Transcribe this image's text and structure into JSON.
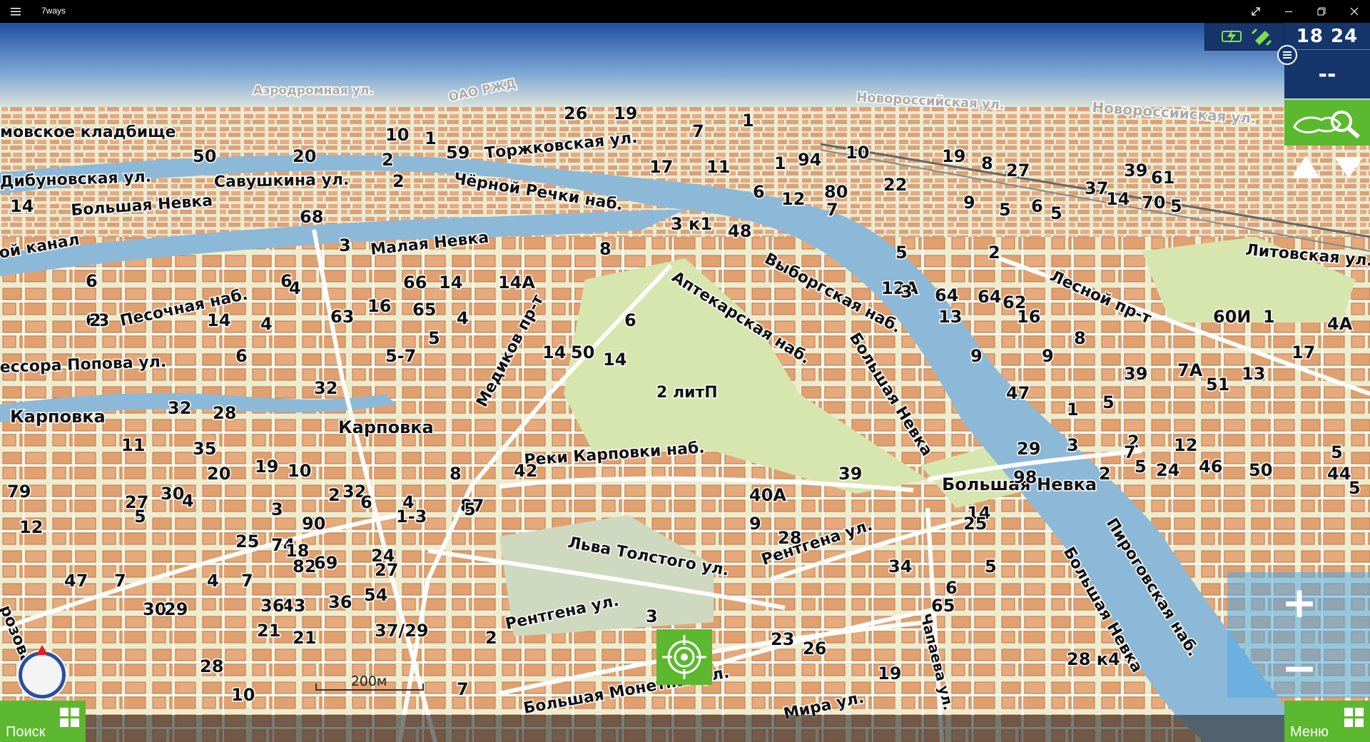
{
  "window": {
    "title": "7ways",
    "controls": [
      "expand-icon",
      "minimize-icon",
      "restore-icon",
      "close-icon"
    ]
  },
  "status": {
    "time": "18 24",
    "secondary": "--",
    "icons": [
      "battery-charging-icon",
      "satellite-icon"
    ]
  },
  "buttons": {
    "search_label": "Поиск",
    "menu_label": "Меню",
    "zoom_in": "+",
    "zoom_out": "−"
  },
  "scale_label": "200м",
  "colors": {
    "accent_green": "#5cb82e",
    "panel_blue": "#16356b",
    "water": "#8db9d8",
    "land": "#efefd0",
    "building": "#e0a070",
    "park": "#cfe2a8",
    "sky_top": "#1f4fa3"
  },
  "map_labels": {
    "streets": [
      "Аэродромная ул.",
      "ОАО РЖД",
      "Торжковская ул.",
      "Новороссийская ул.",
      "Новороссийская ул.",
      "Дибуновская ул.",
      "Савушкина ул.",
      "Чёрной Речки наб.",
      "Большая Невка",
      "Малая Невка",
      "Песочная наб.",
      "Аптекарская наб.",
      "Выборгская наб.",
      "Лесной пр-т",
      "Литовская ул.",
      "Медиков пр-т",
      "ессора Попова ул.",
      "Карповка",
      "Карповка",
      "Реки Карповки наб.",
      "Большая Невка",
      "Большая Невка",
      "Льва Толстого ул.",
      "Рентгена ул.",
      "Рентгена ул.",
      "Большая Невка",
      "Пироговская наб.",
      "Большая Монетная ул.",
      "Мира ул.",
      "Чапаева ул.",
      "мовское кладбище",
      "ой канал",
      "розова ул.",
      "2 литП"
    ],
    "numbers": [
      "26",
      "19",
      "10",
      "1",
      "59",
      "7",
      "1",
      "50",
      "20",
      "2",
      "2",
      "17",
      "11",
      "1",
      "94",
      "10",
      "19",
      "8",
      "27",
      "14",
      "68",
      "3",
      "6",
      "12",
      "80",
      "22",
      "37",
      "39",
      "61",
      "3 к1",
      "48",
      "9",
      "6",
      "5",
      "14",
      "70",
      "5",
      "7",
      "5",
      "5",
      "2",
      "8",
      "6",
      "6",
      "4",
      "66",
      "14",
      "14А",
      "12А",
      "3",
      "64",
      "64",
      "62",
      "63",
      "63",
      "16",
      "65",
      "4",
      "6",
      "13",
      "16",
      "60И",
      "1",
      "4А",
      "2",
      "14",
      "6",
      "4",
      "5-7",
      "5",
      "32",
      "14",
      "50",
      "14",
      "9",
      "9",
      "8",
      "39",
      "7А",
      "51",
      "13",
      "17",
      "32",
      "28",
      "47",
      "1",
      "5",
      "11",
      "35",
      "20",
      "19",
      "10",
      "8",
      "3",
      "2",
      "29",
      "5",
      "7",
      "2",
      "24",
      "46",
      "50",
      "5",
      "42",
      "39",
      "98",
      "79",
      "30",
      "4",
      "32",
      "2",
      "6",
      "4",
      "87",
      "40А",
      "27",
      "14",
      "12",
      "44",
      "5",
      "12",
      "5",
      "3",
      "90",
      "1-3",
      "5",
      "9",
      "28",
      "25",
      "25",
      "74",
      "18",
      "24",
      "82",
      "69",
      "27",
      "34",
      "5",
      "6",
      "65",
      "47",
      "7",
      "4",
      "7",
      "43",
      "54",
      "30",
      "29",
      "36",
      "36",
      "3",
      "2",
      "21",
      "37/29",
      "23",
      "26",
      "19",
      "28 к4",
      "21",
      "28",
      "7",
      "10"
    ]
  }
}
